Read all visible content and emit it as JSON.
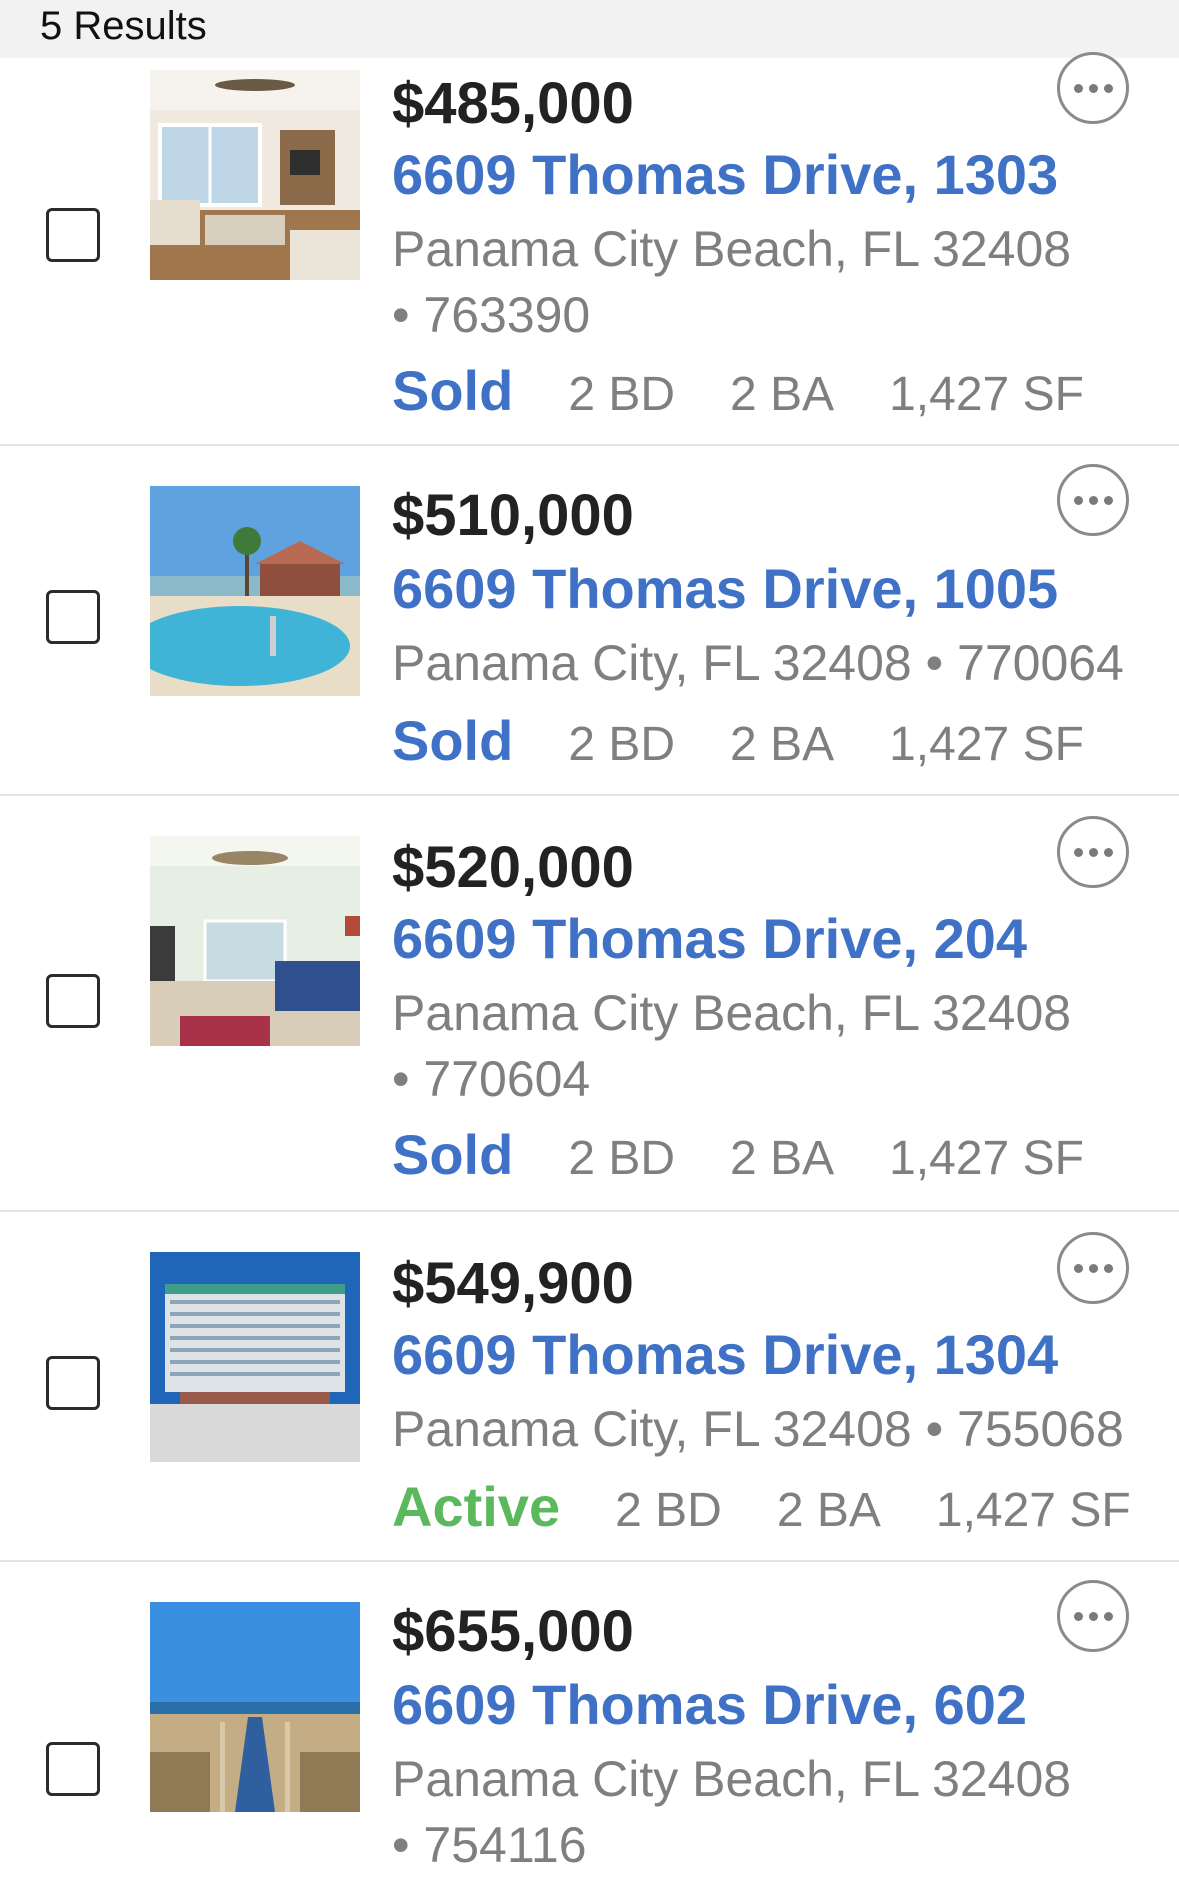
{
  "header": {
    "results_count": "5 Results"
  },
  "listings": [
    {
      "price": "$485,000",
      "address": "6609 Thomas Drive, 1303",
      "city_line": "Panama City Beach, FL 32408",
      "mls_line": "• 763390",
      "status": "Sold",
      "beds": "2 BD",
      "baths": "2 BA",
      "sqft": "1,427 SF",
      "status_color": "#3f72c6"
    },
    {
      "price": "$510,000",
      "address": "6609 Thomas Drive, 1005",
      "city_line": "Panama City, FL 32408 • 770064",
      "mls_line": "",
      "status": "Sold",
      "beds": "2 BD",
      "baths": "2 BA",
      "sqft": "1,427 SF",
      "status_color": "#3f72c6"
    },
    {
      "price": "$520,000",
      "address": "6609 Thomas Drive, 204",
      "city_line": "Panama City Beach, FL 32408",
      "mls_line": "• 770604",
      "status": "Sold",
      "beds": "2 BD",
      "baths": "2 BA",
      "sqft": "1,427 SF",
      "status_color": "#3f72c6"
    },
    {
      "price": "$549,900",
      "address": "6609 Thomas Drive, 1304",
      "city_line": "Panama City, FL 32408 • 755068",
      "mls_line": "",
      "status": "Active",
      "beds": "2 BD",
      "baths": "2 BA",
      "sqft": "1,427 SF",
      "status_color": "#5cb85c"
    },
    {
      "price": "$655,000",
      "address": "6609 Thomas Drive, 602",
      "city_line": "Panama City Beach, FL 32408",
      "mls_line": "• 754116",
      "status": "",
      "beds": "",
      "baths": "",
      "sqft": "",
      "status_color": "#3f72c6"
    }
  ],
  "icons": {
    "more": "more-options-icon",
    "checkbox": "checkbox-unchecked-icon"
  }
}
